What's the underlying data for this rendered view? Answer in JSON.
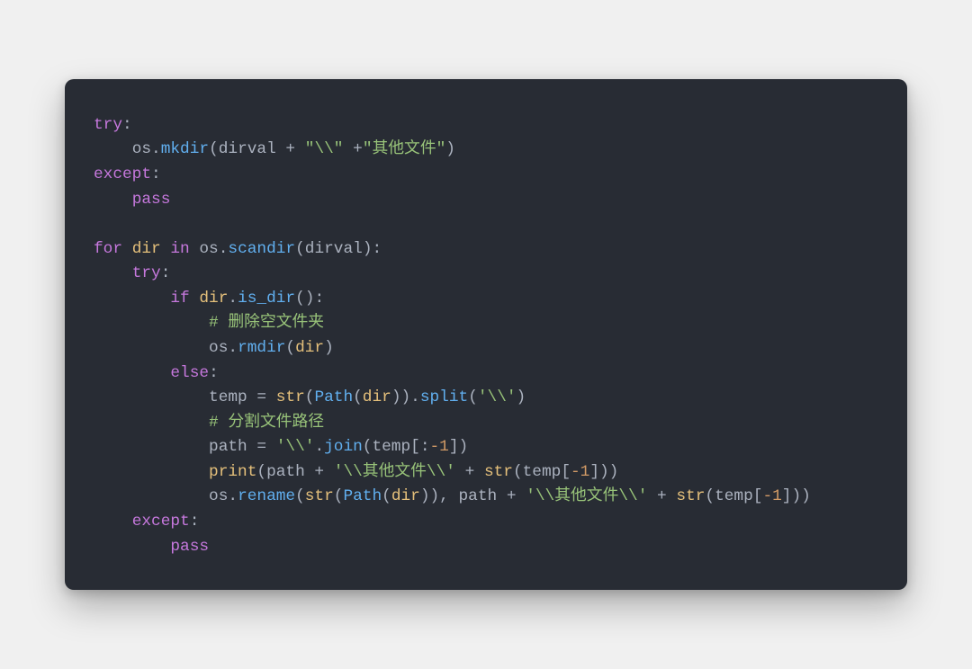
{
  "code": {
    "theme": {
      "background": "#282c34",
      "foreground": "#abb2bf",
      "keyword": "#c678dd",
      "function": "#61afef",
      "string": "#98c379",
      "comment": "#98c379",
      "number": "#d19a66",
      "builtin": "#e5c07b",
      "attribute": "#e06c75"
    },
    "language": "python",
    "lines": [
      {
        "indent": 0,
        "tokens": [
          {
            "t": "try",
            "c": "kw"
          },
          {
            "t": ":",
            "c": "pun"
          }
        ]
      },
      {
        "indent": 1,
        "tokens": [
          {
            "t": "os",
            "c": "var"
          },
          {
            "t": ".",
            "c": "pun"
          },
          {
            "t": "mkdir",
            "c": "fn"
          },
          {
            "t": "(",
            "c": "pun"
          },
          {
            "t": "dirval",
            "c": "var"
          },
          {
            "t": " + ",
            "c": "pun"
          },
          {
            "t": "\"\\\\\"",
            "c": "str"
          },
          {
            "t": " +",
            "c": "pun"
          },
          {
            "t": "\"其他文件\"",
            "c": "str"
          },
          {
            "t": ")",
            "c": "pun"
          }
        ]
      },
      {
        "indent": 0,
        "tokens": [
          {
            "t": "except",
            "c": "kw"
          },
          {
            "t": ":",
            "c": "pun"
          }
        ]
      },
      {
        "indent": 1,
        "tokens": [
          {
            "t": "pass",
            "c": "kw"
          }
        ]
      },
      {
        "indent": 0,
        "tokens": []
      },
      {
        "indent": 0,
        "tokens": [
          {
            "t": "for",
            "c": "kw"
          },
          {
            "t": " ",
            "c": "pun"
          },
          {
            "t": "dir",
            "c": "bi"
          },
          {
            "t": " ",
            "c": "pun"
          },
          {
            "t": "in",
            "c": "kw"
          },
          {
            "t": " ",
            "c": "pun"
          },
          {
            "t": "os",
            "c": "var"
          },
          {
            "t": ".",
            "c": "pun"
          },
          {
            "t": "scandir",
            "c": "fn"
          },
          {
            "t": "(",
            "c": "pun"
          },
          {
            "t": "dirval",
            "c": "var"
          },
          {
            "t": "):",
            "c": "pun"
          }
        ]
      },
      {
        "indent": 1,
        "tokens": [
          {
            "t": "try",
            "c": "kw"
          },
          {
            "t": ":",
            "c": "pun"
          }
        ]
      },
      {
        "indent": 2,
        "tokens": [
          {
            "t": "if",
            "c": "kw"
          },
          {
            "t": " ",
            "c": "pun"
          },
          {
            "t": "dir",
            "c": "bi"
          },
          {
            "t": ".",
            "c": "pun"
          },
          {
            "t": "is_dir",
            "c": "fn"
          },
          {
            "t": "():",
            "c": "pun"
          }
        ]
      },
      {
        "indent": 3,
        "tokens": [
          {
            "t": "# 删除空文件夹",
            "c": "cmt"
          }
        ]
      },
      {
        "indent": 3,
        "tokens": [
          {
            "t": "os",
            "c": "var"
          },
          {
            "t": ".",
            "c": "pun"
          },
          {
            "t": "rmdir",
            "c": "fn"
          },
          {
            "t": "(",
            "c": "pun"
          },
          {
            "t": "dir",
            "c": "bi"
          },
          {
            "t": ")",
            "c": "pun"
          }
        ]
      },
      {
        "indent": 2,
        "tokens": [
          {
            "t": "else",
            "c": "kw"
          },
          {
            "t": ":",
            "c": "pun"
          }
        ]
      },
      {
        "indent": 3,
        "tokens": [
          {
            "t": "temp",
            "c": "var"
          },
          {
            "t": " = ",
            "c": "pun"
          },
          {
            "t": "str",
            "c": "bi"
          },
          {
            "t": "(",
            "c": "pun"
          },
          {
            "t": "Path",
            "c": "fn"
          },
          {
            "t": "(",
            "c": "pun"
          },
          {
            "t": "dir",
            "c": "bi"
          },
          {
            "t": ")).",
            "c": "pun"
          },
          {
            "t": "split",
            "c": "fn"
          },
          {
            "t": "(",
            "c": "pun"
          },
          {
            "t": "'\\\\'",
            "c": "str"
          },
          {
            "t": ")",
            "c": "pun"
          }
        ]
      },
      {
        "indent": 3,
        "tokens": [
          {
            "t": "# 分割文件路径",
            "c": "cmt"
          }
        ]
      },
      {
        "indent": 3,
        "tokens": [
          {
            "t": "path",
            "c": "var"
          },
          {
            "t": " = ",
            "c": "pun"
          },
          {
            "t": "'\\\\'",
            "c": "str"
          },
          {
            "t": ".",
            "c": "pun"
          },
          {
            "t": "join",
            "c": "fn"
          },
          {
            "t": "(",
            "c": "pun"
          },
          {
            "t": "temp",
            "c": "var"
          },
          {
            "t": "[:",
            "c": "pun"
          },
          {
            "t": "-1",
            "c": "num"
          },
          {
            "t": "])",
            "c": "pun"
          }
        ]
      },
      {
        "indent": 3,
        "tokens": [
          {
            "t": "print",
            "c": "bi"
          },
          {
            "t": "(",
            "c": "pun"
          },
          {
            "t": "path",
            "c": "var"
          },
          {
            "t": " + ",
            "c": "pun"
          },
          {
            "t": "'\\\\其他文件\\\\'",
            "c": "str"
          },
          {
            "t": " + ",
            "c": "pun"
          },
          {
            "t": "str",
            "c": "bi"
          },
          {
            "t": "(",
            "c": "pun"
          },
          {
            "t": "temp",
            "c": "var"
          },
          {
            "t": "[",
            "c": "pun"
          },
          {
            "t": "-1",
            "c": "num"
          },
          {
            "t": "]))",
            "c": "pun"
          }
        ]
      },
      {
        "indent": 3,
        "tokens": [
          {
            "t": "os",
            "c": "var"
          },
          {
            "t": ".",
            "c": "pun"
          },
          {
            "t": "rename",
            "c": "fn"
          },
          {
            "t": "(",
            "c": "pun"
          },
          {
            "t": "str",
            "c": "bi"
          },
          {
            "t": "(",
            "c": "pun"
          },
          {
            "t": "Path",
            "c": "fn"
          },
          {
            "t": "(",
            "c": "pun"
          },
          {
            "t": "dir",
            "c": "bi"
          },
          {
            "t": ")), ",
            "c": "pun"
          },
          {
            "t": "path",
            "c": "var"
          },
          {
            "t": " + ",
            "c": "pun"
          },
          {
            "t": "'\\\\其他文件\\\\'",
            "c": "str"
          },
          {
            "t": " + ",
            "c": "pun"
          },
          {
            "t": "str",
            "c": "bi"
          },
          {
            "t": "(",
            "c": "pun"
          },
          {
            "t": "temp",
            "c": "var"
          },
          {
            "t": "[",
            "c": "pun"
          },
          {
            "t": "-1",
            "c": "num"
          },
          {
            "t": "]))",
            "c": "pun"
          }
        ]
      },
      {
        "indent": 1,
        "tokens": [
          {
            "t": "except",
            "c": "kw"
          },
          {
            "t": ":",
            "c": "pun"
          }
        ]
      },
      {
        "indent": 2,
        "tokens": [
          {
            "t": "pass",
            "c": "kw"
          }
        ]
      }
    ],
    "indent_unit": "    "
  }
}
